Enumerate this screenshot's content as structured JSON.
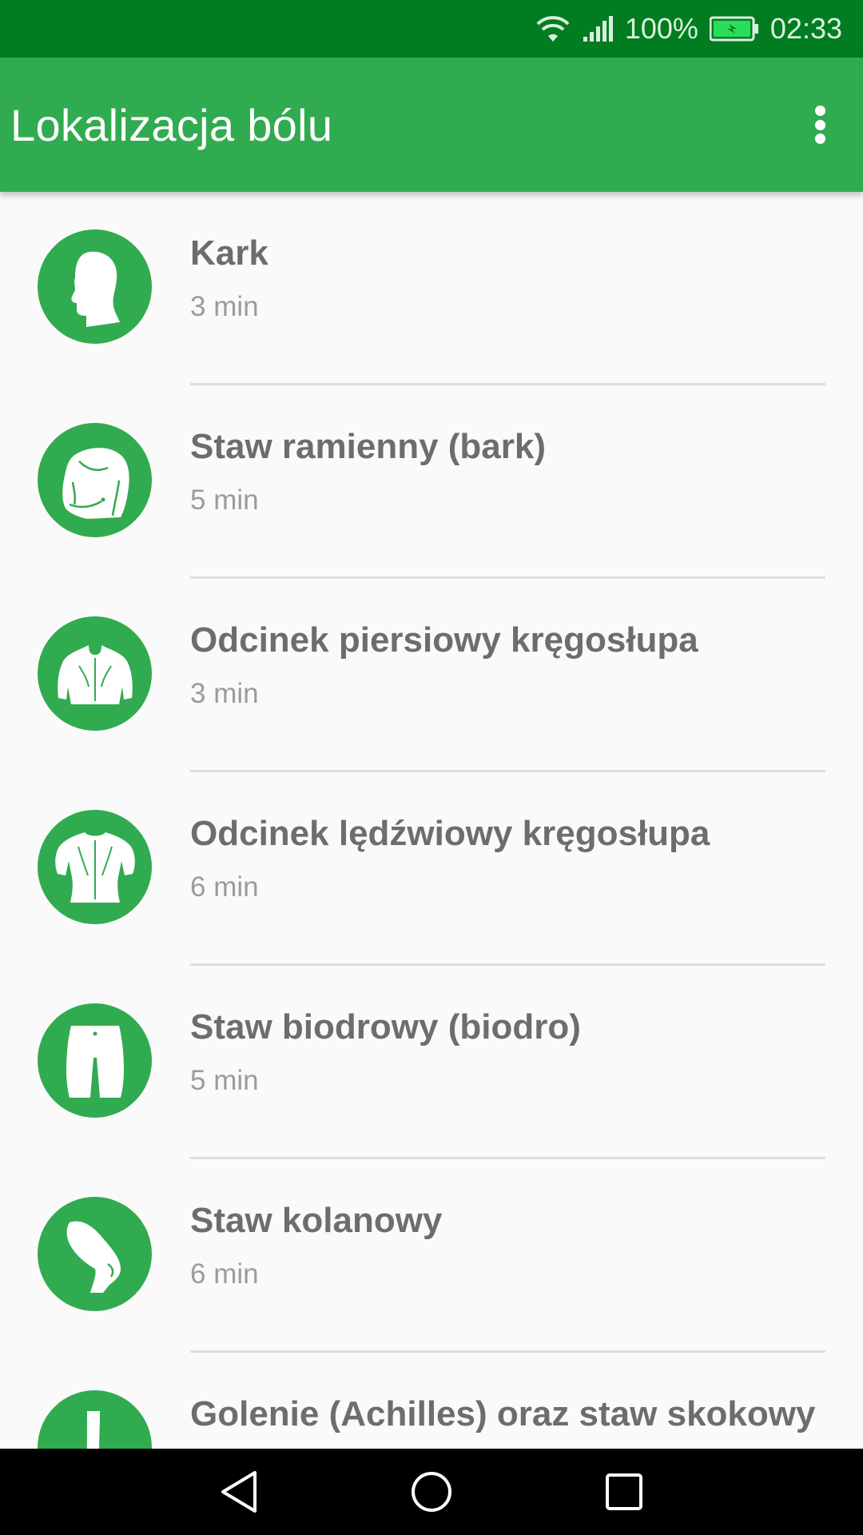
{
  "status_bar": {
    "battery_percent": "100%",
    "time": "02:33",
    "icons": [
      "wifi-icon",
      "cellular-signal-icon",
      "battery-charging-icon"
    ]
  },
  "app_bar": {
    "title": "Lokalizacja bólu",
    "menu_icon": "more-vert-icon"
  },
  "items": [
    {
      "label": "Kark",
      "duration": "3 min",
      "icon": "head-neck-icon"
    },
    {
      "label": "Staw ramienny (bark)",
      "duration": "5 min",
      "icon": "shoulder-icon"
    },
    {
      "label": "Odcinek piersiowy kręgosłupa",
      "duration": "3 min",
      "icon": "upper-back-icon"
    },
    {
      "label": "Odcinek lędźwiowy kręgosłupa",
      "duration": "6 min",
      "icon": "lower-back-icon"
    },
    {
      "label": "Staw biodrowy (biodro)",
      "duration": "5 min",
      "icon": "hip-icon"
    },
    {
      "label": "Staw kolanowy",
      "duration": "6 min",
      "icon": "knee-icon"
    },
    {
      "label": "Golenie (Achilles) oraz staw skokowy",
      "duration": "",
      "icon": "lower-leg-icon"
    }
  ],
  "nav_bar": {
    "buttons": [
      "back-icon",
      "home-icon",
      "recents-icon"
    ]
  },
  "colors": {
    "status_bar": "#017c20",
    "app_bar": "#31ab50",
    "accent": "#31ab50",
    "background": "#fafafa",
    "title_text": "#6d6d6d",
    "subtitle_text": "#9b9b9b"
  }
}
